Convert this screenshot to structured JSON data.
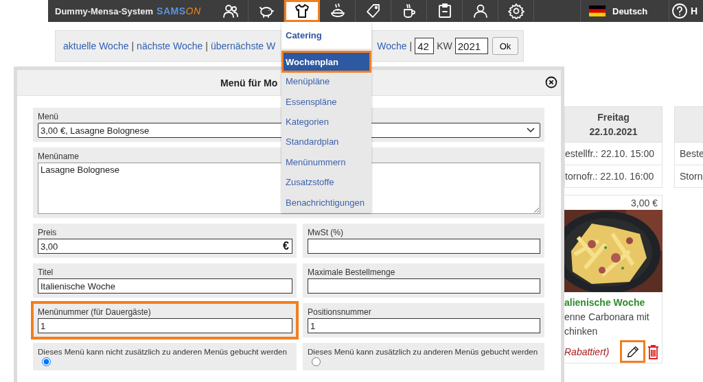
{
  "top_bar": {
    "title": "Dummy-Mensa-System",
    "logo": [
      {
        "text": "SAMS",
        "kind": "outline"
      },
      {
        "text": "ON",
        "kind": "accent"
      }
    ],
    "nav": [
      {
        "selected": false
      },
      {
        "selected": false
      },
      {
        "selected": true
      },
      {
        "selected": false
      },
      {
        "selected": false
      },
      {
        "selected": false
      },
      {
        "selected": false
      },
      {
        "selected": false
      },
      {
        "selected": false
      }
    ],
    "language": "Deutsch",
    "help": "H"
  },
  "week_bar": {
    "separator": "|",
    "links_before": [
      "aktuelle Woche",
      "nächste Woche",
      "übernächste W"
    ],
    "links_after": [
      "Woche"
    ],
    "week": "42",
    "week_label": "KW",
    "year": "2021",
    "button": "Ok"
  },
  "day_columns": [
    {
      "header": [
        "Freitag",
        "22.10.2021"
      ],
      "deadlines": [
        "estellfr.: 22.10. 15:00",
        "tornofr.: 22.10. 16:00"
      ],
      "meals": [
        {
          "price": "3,00 €",
          "picture": {
            "kind": "picture"
          },
          "title": "alienische Woche",
          "description": [
            "enne Carbonara mit",
            "chinken"
          ],
          "note": "Rabattiert)",
          "edit_highlighted": true
        }
      ]
    },
    {
      "deadlines": [
        "Beste",
        "Storn"
      ]
    }
  ],
  "modal": {
    "title": "Menü für Mo",
    "rows": [
      [
        {
          "kind": "select",
          "label": "Menü",
          "value": "3,00 €, Lasagne Bolognese",
          "highlighted": false
        }
      ],
      [
        {
          "kind": "textarea",
          "label": "Menüname",
          "value": "Lasagne Bolognese",
          "highlighted": false
        }
      ],
      [
        {
          "kind": "text",
          "label": "Preis",
          "value": "3,00",
          "suffix": "€",
          "highlighted": false
        },
        {
          "kind": "text",
          "label": "MwSt (%)",
          "highlighted": false
        }
      ],
      [
        {
          "kind": "text",
          "label": "Titel",
          "value": "Italienische Woche",
          "highlighted": false
        },
        {
          "kind": "text",
          "label": "Maximale Bestellmenge",
          "highlighted": false
        }
      ],
      [
        {
          "kind": "text",
          "label": "Menünummer (für Dauergäste)",
          "value": "1",
          "highlighted": true
        },
        {
          "kind": "text",
          "label": "Positionsnummer",
          "value": "1",
          "highlighted": false
        }
      ],
      [
        {
          "kind": "radio",
          "label": "Dieses Menü kann nicht zusätzlich zu anderen Menüs gebucht werden",
          "selected": true,
          "highlighted": false
        },
        {
          "kind": "radio",
          "label": "Dieses Menü kann zusätzlich zu anderen Menüs gebucht werden",
          "selected": false,
          "highlighted": false
        }
      ]
    ]
  },
  "dropdown": {
    "heading": "Catering",
    "items": [
      {
        "label": "Wochenplan",
        "selected": true
      },
      {
        "label": "Menüpläne",
        "selected": false
      },
      {
        "label": "Essenspläne",
        "selected": false
      },
      {
        "label": "Kategorien",
        "selected": false
      },
      {
        "label": "Standardplan",
        "selected": false
      },
      {
        "label": "Menünummern",
        "selected": false
      },
      {
        "label": "Zusatzstoffe",
        "selected": false
      },
      {
        "label": "Benachrichtigungen",
        "selected": false
      }
    ]
  }
}
